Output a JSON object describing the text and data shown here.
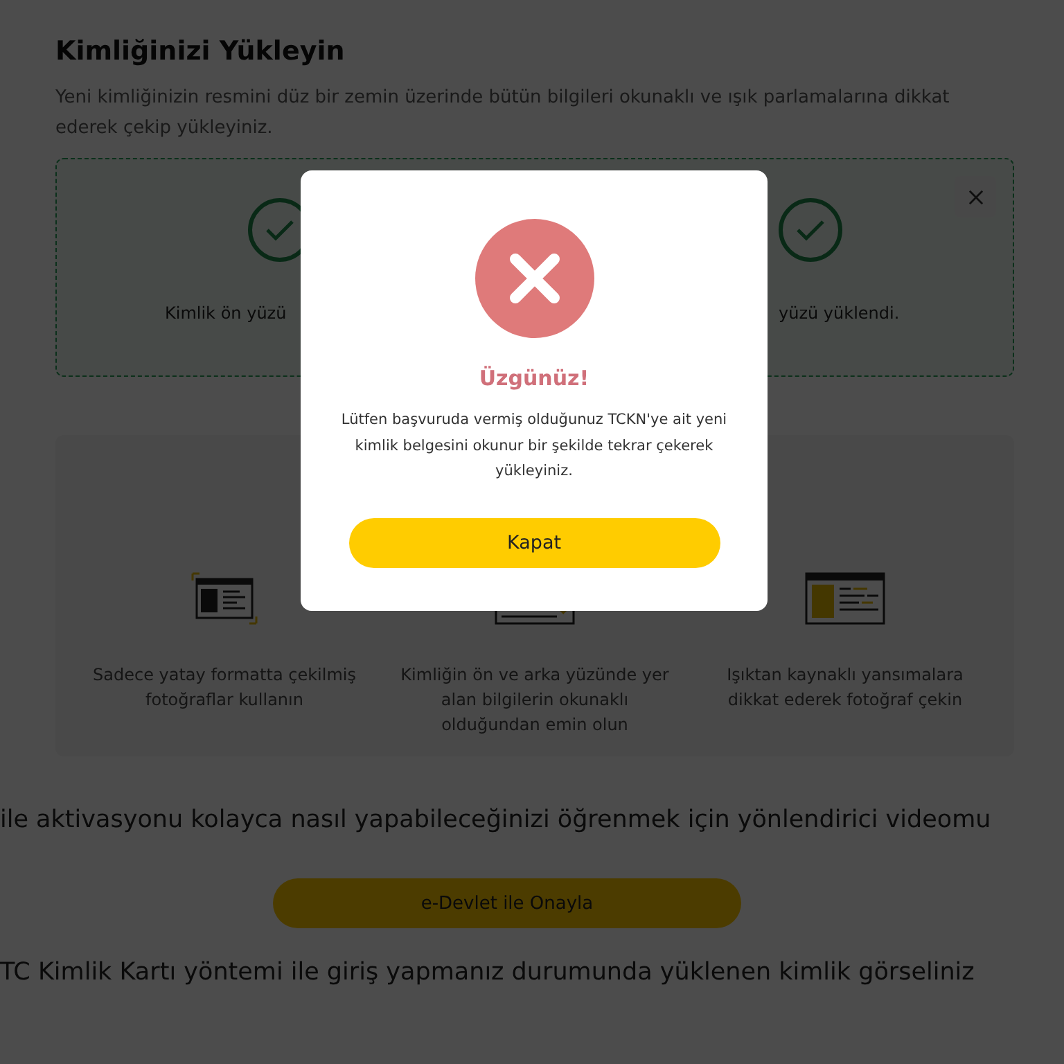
{
  "page": {
    "title": "Kimliğinizi Yükleyin",
    "description": "Yeni kimliğinizin resmini düz bir zemin üzerinde bütün bilgileri okunaklı ve ışık parlamalarına dikkat ederek çekip yükleyiniz."
  },
  "upload": {
    "sides": [
      {
        "label": "Kimlik ön yüzü",
        "uploaded": true
      },
      {
        "label": "yüzü yüklendi.",
        "uploaded": true
      }
    ]
  },
  "tips": [
    {
      "text": "Sadece yatay formatta çekilmiş fotoğraflar kullanın",
      "kind": "landscape"
    },
    {
      "text": "Kimliğin ön ve arka yüzünde yer alan bilgilerin okunaklı olduğundan emin olun",
      "kind": "magnify"
    },
    {
      "text": "Işıktan kaynaklı yansımalara dikkat ederek fotoğraf çekin",
      "kind": "glare"
    }
  ],
  "video_text": "ile aktivasyonu kolayca nasıl yapabileceğinizi öğrenmek için yönlendirici videomu",
  "edevlet_button": "e-Devlet ile Onayla",
  "footer_text": "TC Kimlik Kartı yöntemi ile giriş yapmanız durumunda yüklenen kimlik görseliniz",
  "dialog": {
    "title": "Üzgünüz!",
    "message": "Lütfen başvuruda vermiş olduğunuz TCKN'ye ait yeni kimlik belgesini okunur bir şekilde tekrar çekerek yükleyiniz.",
    "button": "Kapat"
  }
}
